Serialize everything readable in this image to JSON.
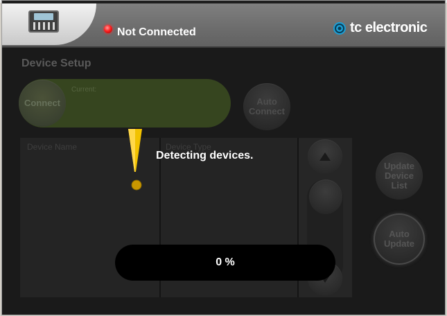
{
  "header": {
    "status_text": "Not Connected",
    "brand": "tc electronic",
    "icons": {
      "device": "mixer-device-icon",
      "status": "red-status-led",
      "brand": "tc-logo-icon"
    }
  },
  "setup": {
    "title": "Device Setup",
    "current_label": "Current:",
    "connect_label": "Connect",
    "auto_connect_label": "Auto\nConnect"
  },
  "device_list": {
    "columns": [
      "Device Name",
      "Device Type"
    ],
    "rows": []
  },
  "side_buttons": {
    "update_device_list": "Update\nDevice\nList",
    "auto_update": "Auto\nUpdate"
  },
  "overlay": {
    "message": "Detecting devices.",
    "progress_text": "0 %",
    "progress": 0
  },
  "colors": {
    "accent_yellow": "#f2c200",
    "status_red": "#ff2020",
    "current_bar": "#36451f"
  }
}
